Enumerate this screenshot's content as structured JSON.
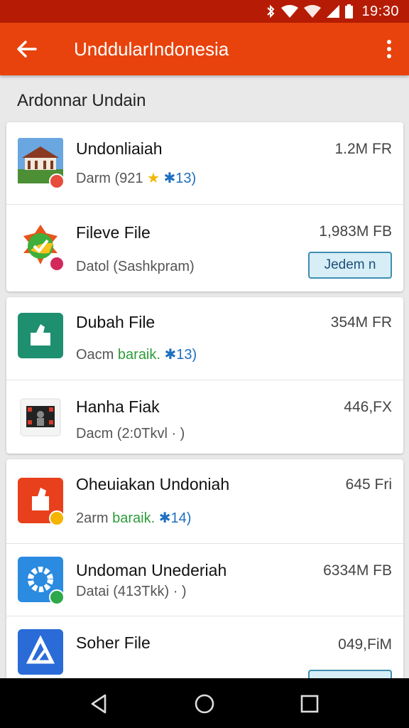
{
  "status_bar": {
    "time": "19:30",
    "icons": [
      "bluetooth-icon",
      "wifi-icon",
      "wifi-icon",
      "signal-icon",
      "battery-icon"
    ]
  },
  "app_bar": {
    "title": "UnddularIndonesia",
    "back_icon": "arrow-left-icon",
    "menu_icon": "more-vert-icon",
    "color": "#e8430d"
  },
  "section": {
    "title": "Ardonnar Undain"
  },
  "cards": [
    {
      "items": [
        {
          "name": "Undonliaiah",
          "sub_prefix": "Darm (921",
          "sub_star": "★",
          "sub_highlight": "✱13)",
          "size": "1.2M FR",
          "icon": "building-photo-icon",
          "badge_icon": "block-badge-icon"
        },
        {
          "name": "Fileve File",
          "sub_prefix": "Datol (Sashkpram)",
          "size": "1,983M FB",
          "icon": "colorful-check-icon",
          "badge_icon": "app-badge-icon",
          "button": "Jedem n"
        }
      ]
    },
    {
      "items": [
        {
          "name": "Dubah File",
          "sub_prefix": "Oacm",
          "sub_green": "baraik.",
          "sub_highlight": "✱13)",
          "size": "354M FR",
          "icon": "green-hand-icon"
        },
        {
          "name": "Hanha Fiak",
          "sub_prefix": "Dacm (2:0Tkvl  ·   )",
          "size": "446,FX",
          "icon": "film-icon"
        }
      ]
    },
    {
      "items": [
        {
          "name": "Oheuiakan Undoniah",
          "sub_prefix": "2arm",
          "sub_green": "baraik.",
          "sub_highlight": "✱14)",
          "size": "645 Fri",
          "icon": "red-hand-icon",
          "badge_icon": "yellow-badge-icon"
        },
        {
          "name": "Undoman Unederiah",
          "sub_prefix": "Datai (413Tkk)  ·   )",
          "size": "6334M FB",
          "icon": "gear-icon",
          "badge_icon": "green-badge-icon"
        },
        {
          "name": "Soher File",
          "sub_prefix": "",
          "size": "049,FiM",
          "icon": "triangle-logo-icon"
        }
      ]
    }
  ],
  "nav_bar": {
    "icons": [
      "back-triangle-icon",
      "home-circle-icon",
      "recents-square-icon"
    ]
  }
}
